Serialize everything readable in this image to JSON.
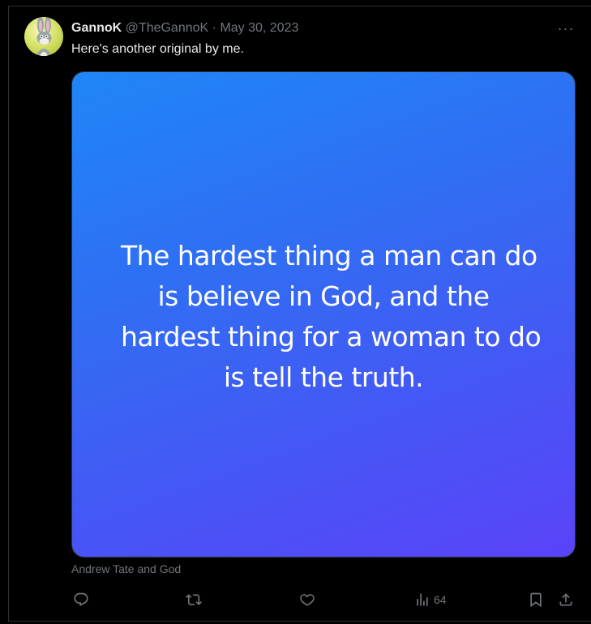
{
  "tweet": {
    "author_name": "GannoK",
    "author_handle": "@TheGannoK",
    "separator": "·",
    "date": "May 30, 2023",
    "more_label": "···",
    "text": "Here's another original by me.",
    "media": {
      "quote_lines": [
        "The hardest thing a man can do",
        "is believe in God, and the",
        "hardest thing for a woman to do",
        "is tell the truth."
      ],
      "gradient_colors": [
        "#1f86f7",
        "#5a43f9"
      ]
    },
    "media_caption": "Andrew Tate and God",
    "actions": {
      "reply_icon": "reply-icon",
      "retweet_icon": "retweet-icon",
      "like_icon": "heart-icon",
      "views_icon": "views-chart-icon",
      "views_count": "64",
      "bookmark_icon": "bookmark-icon",
      "share_icon": "share-icon"
    }
  },
  "colors": {
    "background": "#000000",
    "primary_text": "#e7e9ea",
    "secondary_text": "#71767b",
    "border": "#2f3336"
  }
}
